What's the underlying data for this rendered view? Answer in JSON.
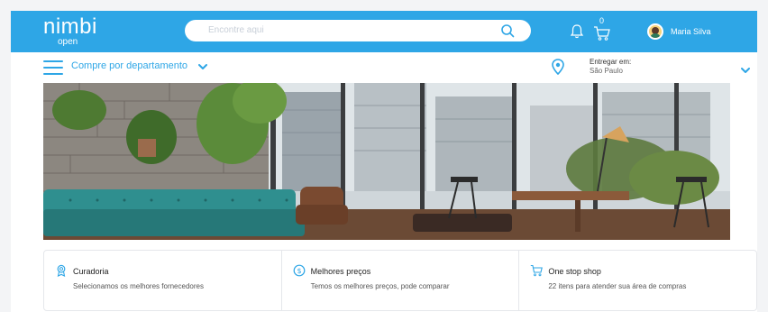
{
  "header": {
    "logo": {
      "primary": "nimbi",
      "secondary": "open"
    },
    "search": {
      "placeholder": "Encontre aqui"
    },
    "cart_count": "0",
    "user_name": "Maria Silva"
  },
  "subnav": {
    "departments_label": "Compre por departamento",
    "delivery_label": "Entregar em:",
    "delivery_city": "São Paulo"
  },
  "features": [
    {
      "icon": "award-icon",
      "title": "Curadoria",
      "description": "Selecionamos os melhores fornecedores"
    },
    {
      "icon": "dollar-icon",
      "title": "Melhores preços",
      "description": "Temos os melhores preços, pode comparar"
    },
    {
      "icon": "cart-icon",
      "title": "One stop shop",
      "description": "22 itens para atender sua área de compras"
    }
  ],
  "colors": {
    "brand": "#2ea6e6",
    "text": "#222222",
    "muted": "#555555"
  }
}
